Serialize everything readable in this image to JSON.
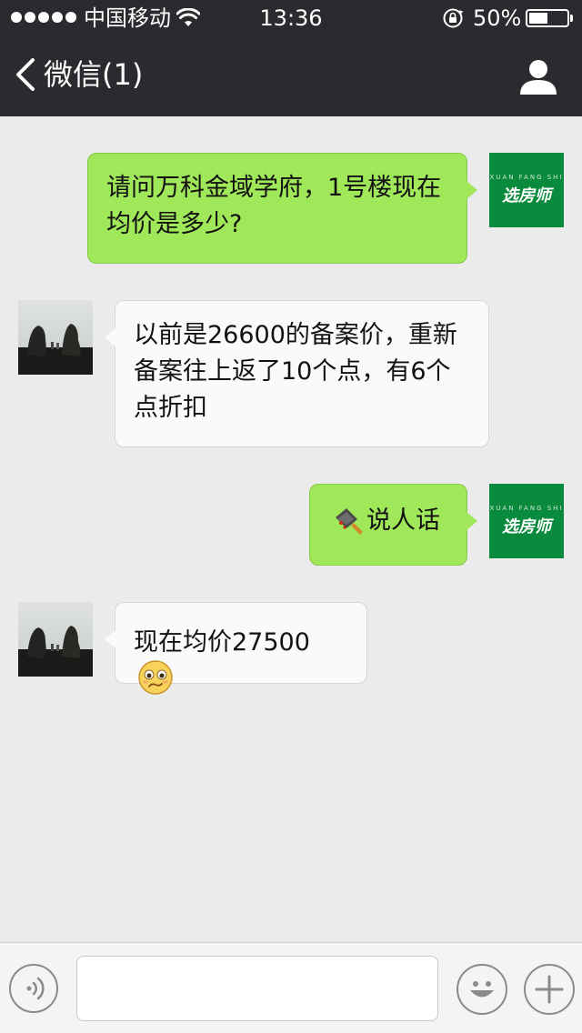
{
  "status_bar": {
    "carrier": "中国移动",
    "time": "13:36",
    "battery": "50%",
    "battery_level": 0.5,
    "signal_dots": 5,
    "icons": [
      "signal-dots-icon",
      "wifi-icon",
      "rotation-lock-icon",
      "battery-icon"
    ]
  },
  "nav": {
    "back_label": "微信(1)",
    "icons": [
      "back-chevron-icon",
      "profile-icon"
    ]
  },
  "brand_avatar": {
    "small_text": "XUAN FANG SHI",
    "text": "选房师",
    "color": "#0a8a3c"
  },
  "messages": [
    {
      "direction": "out",
      "sender": "brand",
      "text": "请问万科金域学府，1号楼现在均价是多少?"
    },
    {
      "direction": "in",
      "sender": "photo",
      "text": "以前是26600的备案价，重新备案往上返了10个点，有6个点折扣"
    },
    {
      "direction": "out",
      "sender": "brand",
      "emoji": "cleaver-icon",
      "text": "说人话"
    },
    {
      "direction": "in",
      "sender": "photo",
      "text": "现在均价27500",
      "emoji": "worried-face-icon"
    }
  ],
  "input_bar": {
    "placeholder": "",
    "icons": [
      "voice-icon",
      "emoji-icon",
      "plus-icon"
    ]
  },
  "colors": {
    "header_bg": "#2b2b2f",
    "chat_bg": "#ebebeb",
    "out_bubble": "#a0e75a",
    "in_bubble": "#fafafa"
  }
}
